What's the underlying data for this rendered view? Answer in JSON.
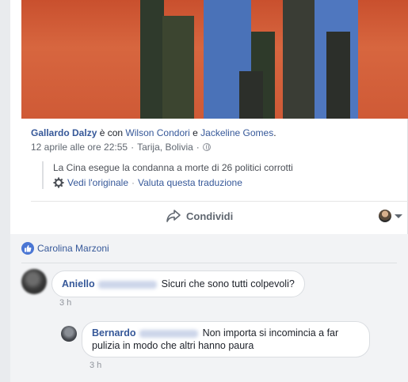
{
  "post": {
    "author": "Gallardo Dalzy",
    "with_text": "è con",
    "tagged_1": "Wilson Condori",
    "and_text": "e",
    "tagged_2": "Jackeline Gomes",
    "period": ".",
    "date": "12 aprile alle ore 22:55",
    "dot": "·",
    "location": "Tarija, Bolivia",
    "dot2": "·",
    "privacy_icon": "globe-icon"
  },
  "translation": {
    "text": "La Cina esegue la condanna a morte di 26 politici corrotti",
    "see_original": "Vedi l'originale",
    "separator": "·",
    "rate": "Valuta questa traduzione"
  },
  "actions": {
    "share_label": "Condividi"
  },
  "reactions": {
    "liker": "Carolina Marzoni"
  },
  "comments": [
    {
      "author": "Aniello",
      "text": "Sicuri che sono tutti colpevoli?",
      "time": "3 h"
    },
    {
      "author": "Bernardo",
      "text": "Non importa si incomincia a far pulizia in modo che altri hanno paura",
      "time": "3 h"
    }
  ],
  "colors": {
    "link": "#365899",
    "like_blue": "#4a76d4",
    "background": "#e9ebee"
  }
}
